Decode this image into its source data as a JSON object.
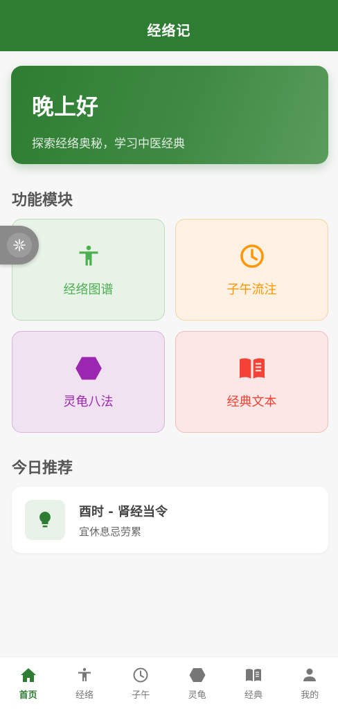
{
  "header": {
    "title": "经络记"
  },
  "greeting": {
    "hello": "晚上好",
    "subtitle": "探索经络奥秘，学习中医经典"
  },
  "sections": {
    "modules": "功能模块",
    "today": "今日推荐"
  },
  "modules": [
    {
      "label": "经络图谱",
      "icon": "accessibility-icon",
      "color": "#4caf50"
    },
    {
      "label": "子午流注",
      "icon": "clock-icon",
      "color": "#ff9800"
    },
    {
      "label": "灵龟八法",
      "icon": "hexagon-icon",
      "color": "#9c27b0"
    },
    {
      "label": "经典文本",
      "icon": "book-icon",
      "color": "#f44336"
    }
  ],
  "recommendation": {
    "title": "酉时 - 肾经当令",
    "subtitle": "宜休息忌劳累",
    "icon": "lightbulb-icon"
  },
  "nav": [
    {
      "label": "首页",
      "icon": "home-icon",
      "active": true
    },
    {
      "label": "经络",
      "icon": "accessibility-icon",
      "active": false
    },
    {
      "label": "子午",
      "icon": "clock-icon",
      "active": false
    },
    {
      "label": "灵龟",
      "icon": "hexagon-icon",
      "active": false
    },
    {
      "label": "经典",
      "icon": "book-icon",
      "active": false
    },
    {
      "label": "我的",
      "icon": "person-icon",
      "active": false
    }
  ],
  "colors": {
    "primary": "#2e7d32",
    "nav_inactive": "#777777"
  }
}
